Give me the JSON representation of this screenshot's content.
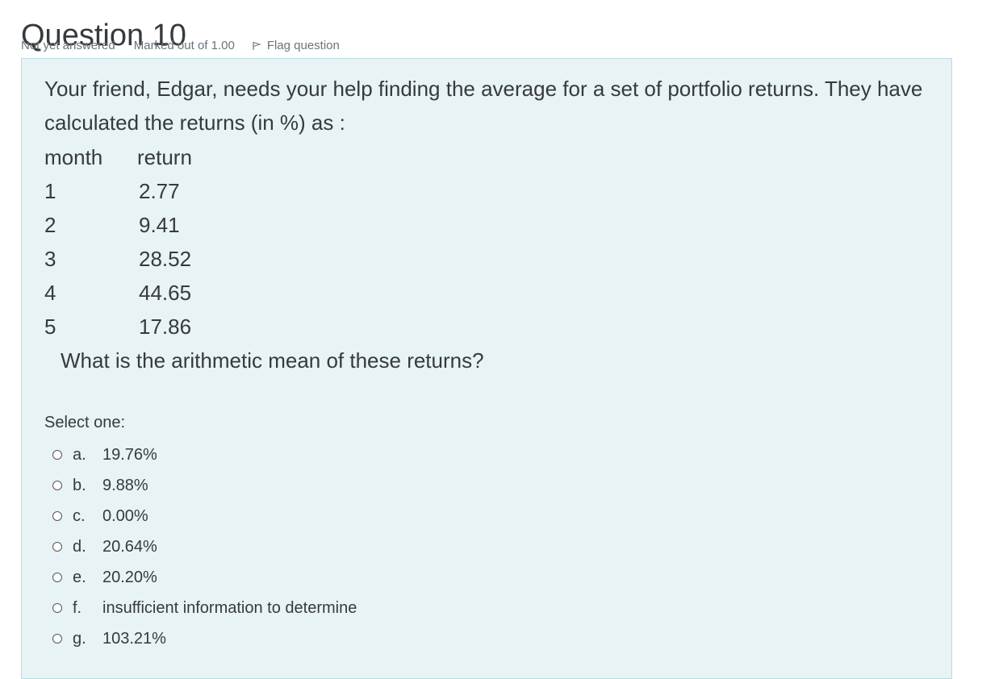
{
  "question": {
    "title": "Question 10",
    "state": "Not yet answered",
    "grade": "Marked out of 1.00",
    "flag_label": "Flag question"
  },
  "content": {
    "intro": "Your friend, Edgar, needs your help finding the average for a set of portfolio returns. They have calculated the returns (in %) as :",
    "table": {
      "headers": [
        "month",
        "return"
      ],
      "rows": [
        [
          "1",
          "2.77"
        ],
        [
          "2",
          "9.41"
        ],
        [
          "3",
          "28.52"
        ],
        [
          "4",
          "44.65"
        ],
        [
          "5",
          "17.86"
        ]
      ]
    },
    "question_text": "What is the arithmetic mean of these returns?"
  },
  "answer": {
    "prompt": "Select one:",
    "options": [
      {
        "letter": "a.",
        "text": "19.76%"
      },
      {
        "letter": "b.",
        "text": "9.88%"
      },
      {
        "letter": "c.",
        "text": "0.00%"
      },
      {
        "letter": "d.",
        "text": "20.64%"
      },
      {
        "letter": "e.",
        "text": "20.20%"
      },
      {
        "letter": "f.",
        "text": "insufficient information to determine"
      },
      {
        "letter": "g.",
        "text": "103.21%"
      }
    ]
  },
  "icons": {
    "flag": "flag-icon",
    "radio": "radio-unchecked-icon"
  }
}
